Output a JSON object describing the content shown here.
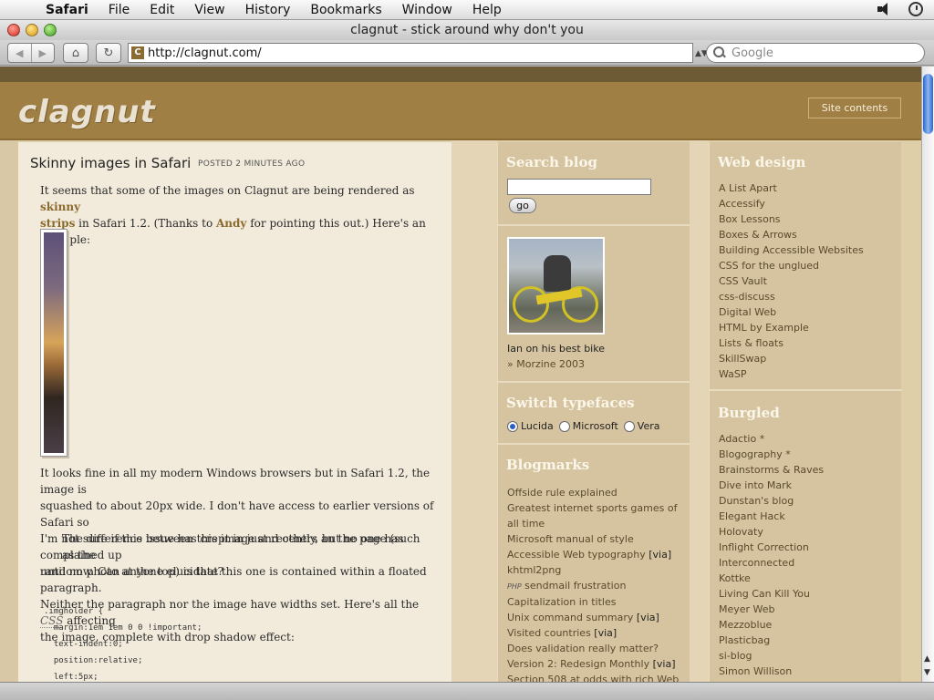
{
  "menubar": {
    "app": "Safari",
    "items": [
      "File",
      "Edit",
      "View",
      "History",
      "Bookmarks",
      "Window",
      "Help"
    ]
  },
  "window": {
    "title": "clagnut - stick around why don't you"
  },
  "toolbar": {
    "url": "http://clagnut.com/",
    "search_placeholder": "Google"
  },
  "site": {
    "logo": "clagnut",
    "site_contents": "Site contents"
  },
  "article": {
    "title": "Skinny images in Safari",
    "posted": "POSTED 2 MINUTES AGO",
    "p1_a": "It seems that some of the images on Clagnut are being rendered as ",
    "p1_link1": "skinny",
    "p1_link1b": "strips",
    "p1_b": " in Safari 1.2. (Thanks to ",
    "p1_link2": "Andy",
    "p1_c": " for pointing this out.) Here's an example:",
    "p2_lines": [
      "It looks fine in all my modern Windows browsers but in Safari 1.2, the image is",
      "squashed to about 20px wide. I don't have access to earlier versions of Safari so",
      "I'm not sure if this issue has crept in just recently, but no one has complained up",
      "until now. Can anyone elucidate?"
    ],
    "p3_lines": [
      "The difference between this image and others an the page (such as the",
      "random photo at the top) is that this one is contained within a floated paragraph.",
      "Neither the paragraph nor the image have widths set. Here's all the "
    ],
    "p3_abbr": "CSS",
    "p3_end": " affecting",
    "p3_last": "the image, complete with drop shadow effect:",
    "code": [
      ".imgholder {",
      "  margin:1em 1em 0 0 !important;",
      "  text-indent:0;",
      "  position:relative;",
      "  left:5px;"
    ]
  },
  "middle": {
    "search_heading": "Search blog",
    "go_label": "go",
    "photo_caption": "Ian on his best bike",
    "photo_link_prefix": "» ",
    "photo_link": "Morzine 2003",
    "typeface_heading": "Switch typefaces",
    "typefaces": [
      "Lucida",
      "Microsoft",
      "Vera"
    ],
    "selected_typeface": "Lucida",
    "blogmarks_heading": "Blogmarks",
    "blogmarks": [
      {
        "text": "Offside rule explained",
        "via": ""
      },
      {
        "text": "Greatest internet sports games of",
        "via": ""
      },
      {
        "text": "all time",
        "via": ""
      },
      {
        "text": "Microsoft manual of style",
        "via": ""
      },
      {
        "text": "Accessible Web typography ",
        "via": "[via]"
      },
      {
        "text": "khtml2png",
        "via": ""
      },
      {
        "text": "sendmail frustration",
        "via": "",
        "prefix": "PHP"
      },
      {
        "text": "Capitalization in titles",
        "via": ""
      },
      {
        "text": "Unix command summary ",
        "via": "[via]"
      },
      {
        "text": "Visited countries ",
        "via": "[via]"
      },
      {
        "text": "Does validation really matter?",
        "via": ""
      },
      {
        "text": "Version 2: Redesign Monthly ",
        "via": "[via]"
      },
      {
        "text": "Section 508 at odds with rich Web",
        "via": ""
      }
    ]
  },
  "right": {
    "webdesign_heading": "Web design",
    "webdesign_links": [
      "A List Apart",
      "Accessify",
      "Box Lessons",
      "Boxes & Arrows",
      "Building Accessible Websites",
      "CSS for the unglued",
      "CSS Vault",
      "css-discuss",
      "Digital Web",
      "HTML by Example",
      "Lists & floats",
      "SkillSwap",
      "WaSP"
    ],
    "burgled_heading": "Burgled",
    "burgled_links": [
      "Adactio *",
      "Blogography *",
      "Brainstorms & Raves",
      "Dive into Mark",
      "Dunstan's blog",
      "Elegant Hack",
      "Holovaty",
      "Inflight Correction",
      "Interconnected",
      "Kottke",
      "Living Can Kill You",
      "Meyer Web",
      "Mezzoblue",
      "Plasticbag",
      "si-blog",
      "Simon Willison"
    ]
  }
}
